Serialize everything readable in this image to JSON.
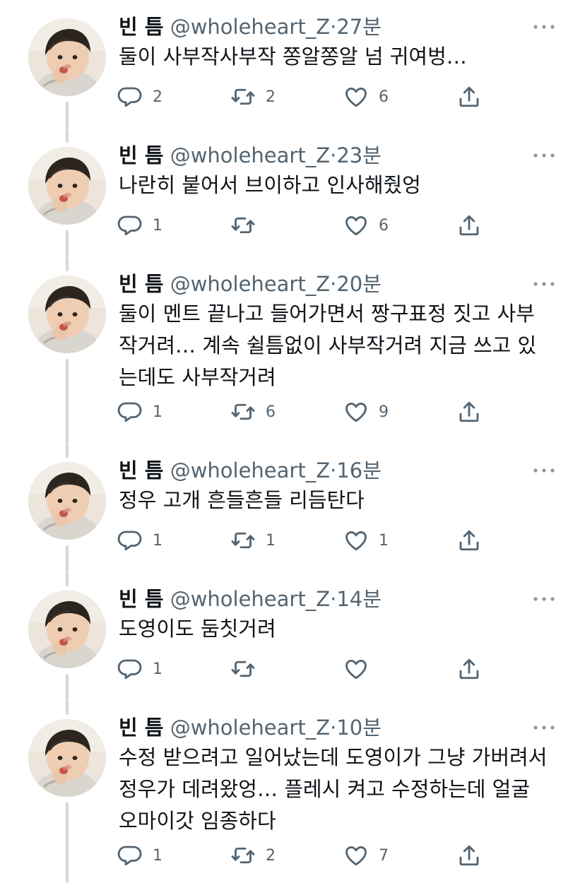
{
  "user": {
    "name": "빈 틈",
    "handle": "@wholeheart_Z",
    "avatar_icon": "profile-photo-child-icon"
  },
  "colors": {
    "text": "#0f1419",
    "secondary": "#536471",
    "thread_line": "#cfd9de"
  },
  "tweets": [
    {
      "time": "27분",
      "lines": [
        "둘이 사부작사부작 쫑알쫑알 넘 귀여벙…"
      ],
      "replies": "2",
      "retweets": "2",
      "likes": "6"
    },
    {
      "time": "23분",
      "lines": [
        "나란히 붙어서 브이하고 인사해줬엉"
      ],
      "replies": "1",
      "retweets": "",
      "likes": "6"
    },
    {
      "time": "20분",
      "lines": [
        "둘이 멘트 끝나고 들어가면서 짱구표정 짓고 사부",
        "작거려… 계속 쉴틈없이 사부작거려 지금 쓰고 있",
        "는데도 사부작거려"
      ],
      "replies": "1",
      "retweets": "6",
      "likes": "9"
    },
    {
      "time": "16분",
      "lines": [
        "정우 고개 흔들흔들 리듬탄다"
      ],
      "replies": "1",
      "retweets": "1",
      "likes": "1"
    },
    {
      "time": "14분",
      "lines": [
        "도영이도 둠칫거려"
      ],
      "replies": "1",
      "retweets": "",
      "likes": ""
    },
    {
      "time": "10분",
      "lines": [
        "수정 받으려고 일어났는데 도영이가 그냥 가버려서",
        "정우가 데려왔엉… 플레시 켜고 수정하는데 얼굴",
        "오마이갓 임종하다"
      ],
      "replies": "1",
      "retweets": "2",
      "likes": "7"
    }
  ]
}
